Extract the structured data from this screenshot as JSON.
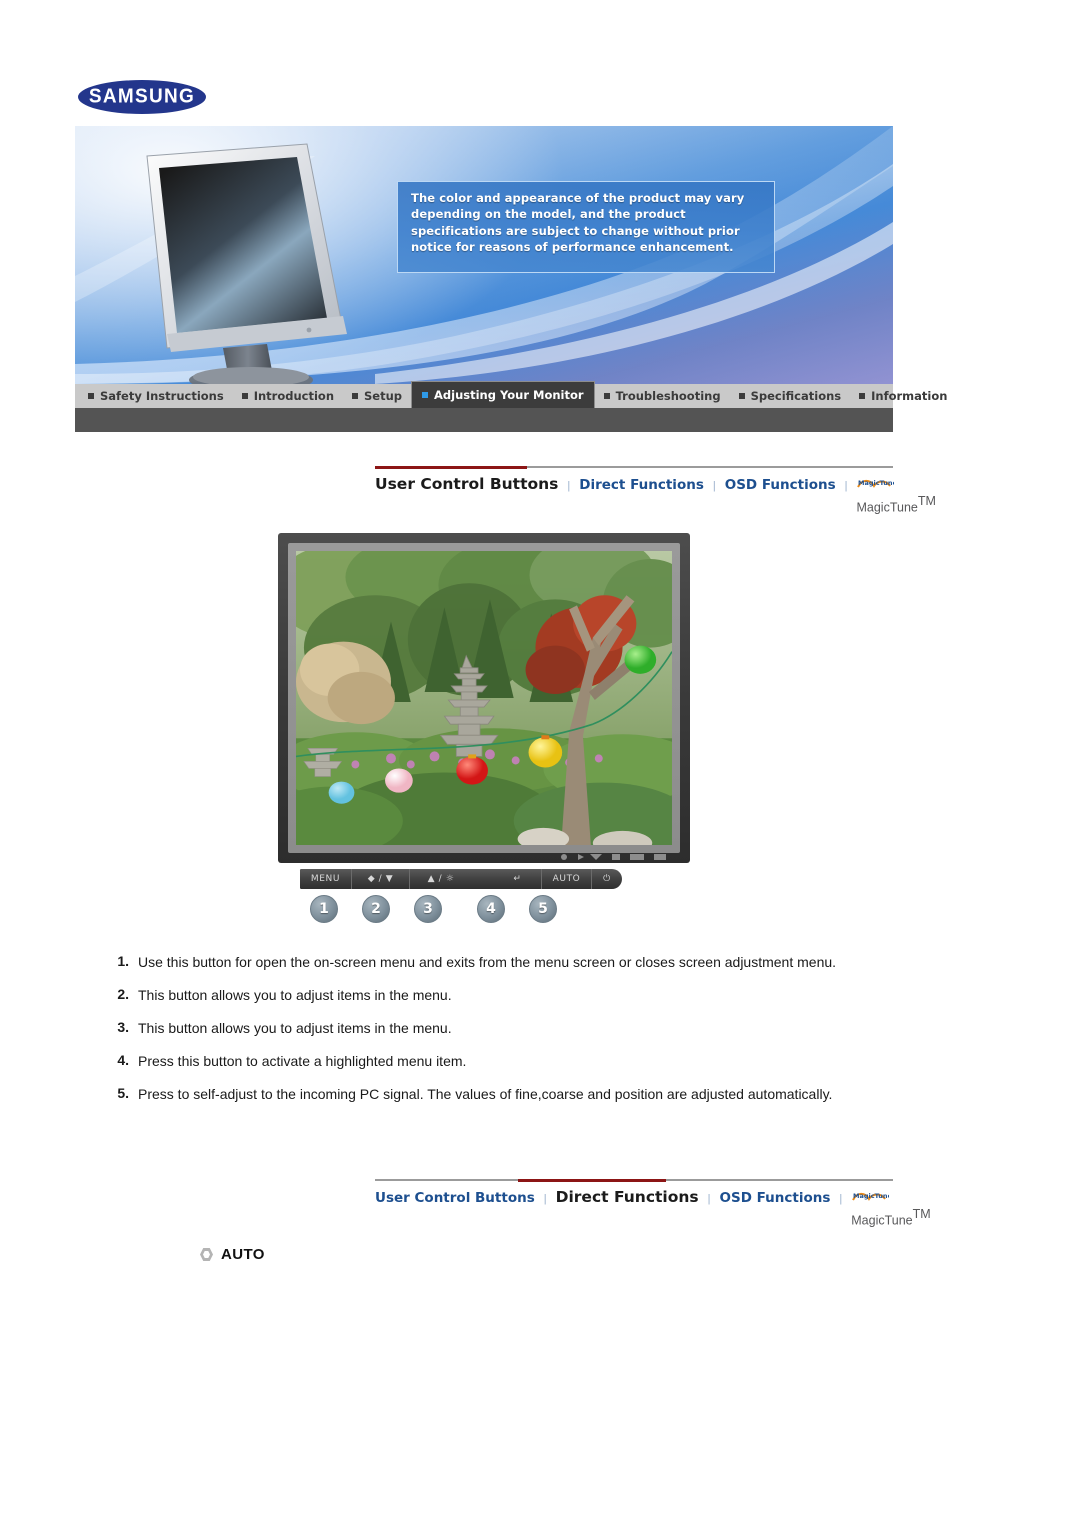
{
  "brand": {
    "logo_text": "SAMSUNG",
    "logo_color": "#23368c"
  },
  "banner": {
    "notice_lines": [
      "The color and appearance of the product may vary",
      "depending on the model, and the product specifica-",
      "tions are subject to change without prior notice for",
      "reasons of performance enhancement."
    ],
    "notice_text": "The color and appearance of the product may vary depending on the model, and the product specifications are subject to change without prior notice for reasons of performance enhancement.",
    "product_image": "lcd-monitor-photo"
  },
  "tabs": [
    {
      "label": "Safety Instructions",
      "active": false
    },
    {
      "label": "Introduction",
      "active": false
    },
    {
      "label": "Setup",
      "active": false
    },
    {
      "label": "Adjusting Your Monitor",
      "active": true
    },
    {
      "label": "Troubleshooting",
      "active": false
    },
    {
      "label": "Specifications",
      "active": false
    },
    {
      "label": "Information",
      "active": false
    }
  ],
  "subnav_top": {
    "items": [
      {
        "label": "User Control Buttons",
        "active": true
      },
      {
        "label": "Direct Functions",
        "active": false
      },
      {
        "label": "OSD Functions",
        "active": false
      },
      {
        "label": "MagicTune",
        "trademark": "TM",
        "active": false,
        "icon": "magictune-logo"
      }
    ],
    "separator": "|",
    "accent_color": "#8c1515"
  },
  "subnav_bottom": {
    "items": [
      {
        "label": "User Control Buttons",
        "active": false
      },
      {
        "label": "Direct Functions",
        "active": true
      },
      {
        "label": "OSD Functions",
        "active": false
      },
      {
        "label": "MagicTune",
        "trademark": "TM",
        "active": false,
        "icon": "magictune-logo"
      }
    ],
    "separator": "|",
    "accent_color": "#8c1515"
  },
  "monitor_figure": {
    "screen_image": "garden-scene-with-stone-pagoda-and-lanterns",
    "control_buttons": [
      {
        "label": "MENU",
        "badge": "1"
      },
      {
        "label": "◆ / ▼",
        "badge": "2"
      },
      {
        "label": "▲ / ☼",
        "badge": "3"
      },
      {
        "label": "↵",
        "badge": "4"
      },
      {
        "label": "AUTO",
        "badge": "5"
      },
      {
        "label": "⏻",
        "badge": ""
      }
    ],
    "badges": [
      "1",
      "2",
      "3",
      "4",
      "5"
    ]
  },
  "instructions": [
    {
      "num": "1.",
      "text": "Use this button for open the on-screen menu and exits from the menu screen or closes screen adjustment menu."
    },
    {
      "num": "2.",
      "text": "This button allows you to adjust items in the menu."
    },
    {
      "num": "3.",
      "text": "This button allows you to adjust items in the menu."
    },
    {
      "num": "4.",
      "text": "Press this button to activate a highlighted menu item."
    },
    {
      "num": "5.",
      "text": "Press to self-adjust to the incoming PC signal. The values of fine,coarse and position are adjusted automatically."
    }
  ],
  "auto_section": {
    "heading": "AUTO",
    "bullet_icon": "hex-bullet-icon"
  }
}
